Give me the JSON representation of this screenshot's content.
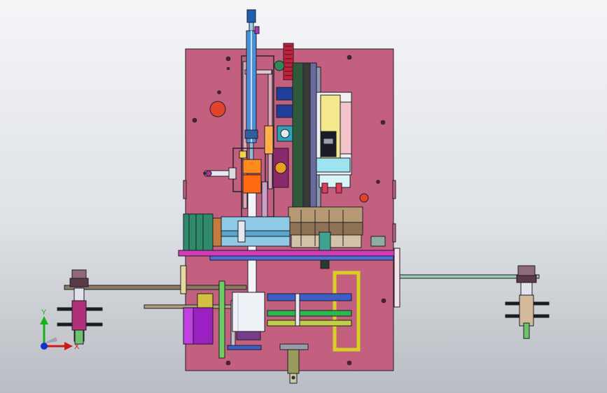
{
  "scene": {
    "background_top": "#f4f5f7",
    "background_bottom": "#b9bdc3",
    "plate_color": "#c4607f",
    "outline_color": "#1e1e28"
  },
  "triad": {
    "x_label": "X",
    "y_label": "Y",
    "x_color": "#d01818",
    "y_color": "#18b018",
    "z_color": "#1830d0"
  },
  "parts": [
    "base-plate",
    "vertical-cylinder-rod",
    "red-pulley",
    "linear-guide-rails",
    "right-slide-assembly",
    "orange-actuator",
    "green-motor-block",
    "left-roller-arm",
    "right-roller-arm",
    "white-gripper-block",
    "purple-cylinder",
    "lower-shaft",
    "yellow-frame"
  ]
}
